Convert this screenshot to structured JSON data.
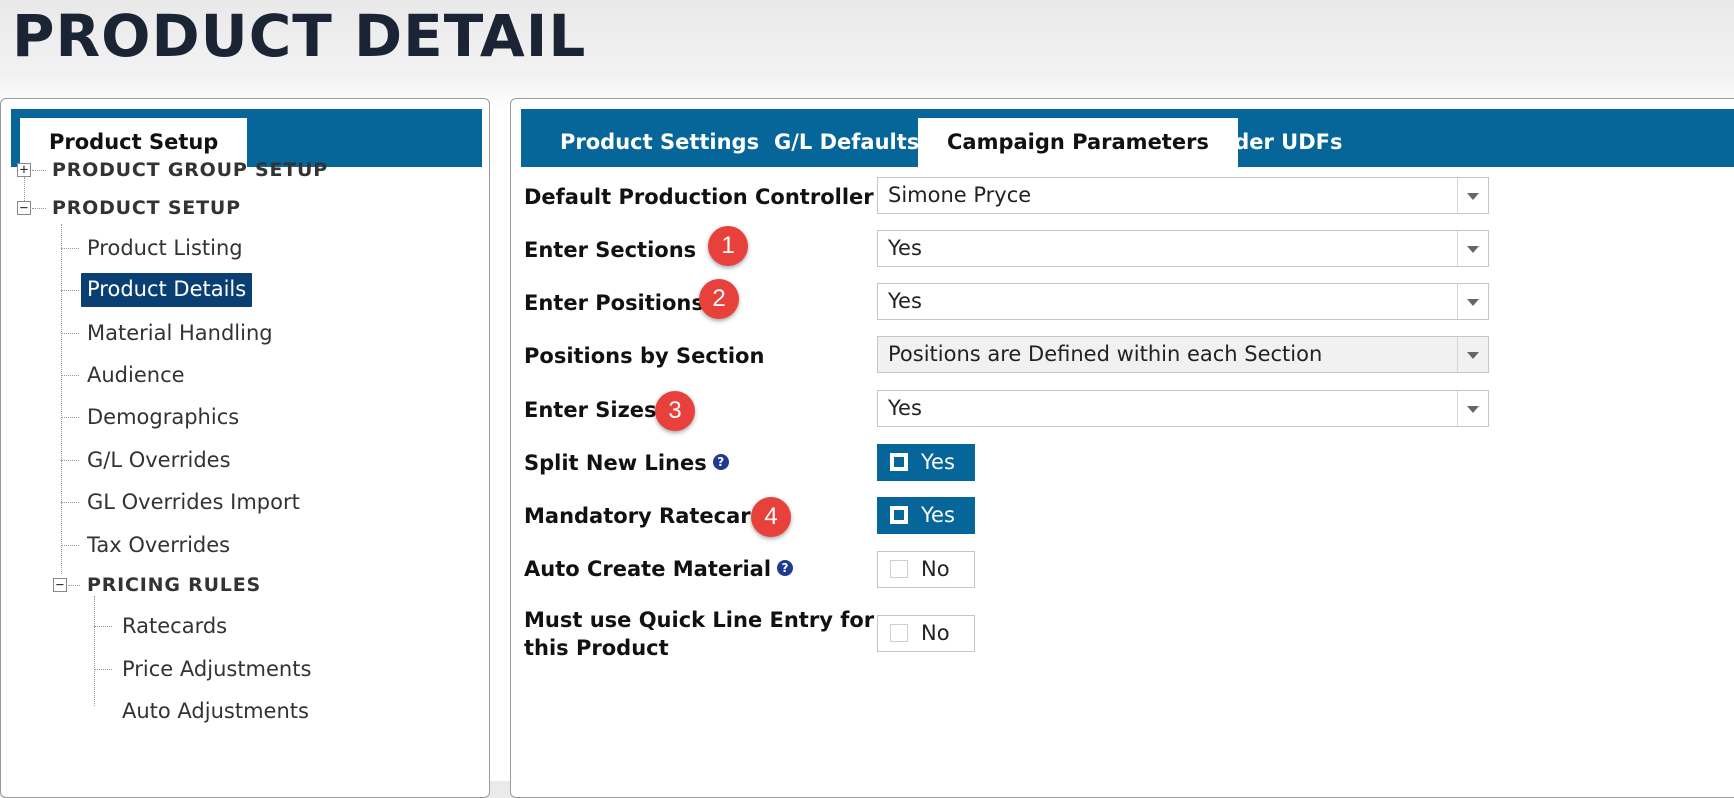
{
  "page": {
    "title": "PRODUCT DETAIL"
  },
  "left_panel": {
    "tabs": [
      {
        "label": "Product Setup",
        "active": true
      }
    ],
    "tree": {
      "group_setup": "PRODUCT GROUP SETUP",
      "product_setup": "PRODUCT SETUP",
      "items": [
        "Product Listing",
        "Product Details",
        "Material Handling",
        "Audience",
        "Demographics",
        "G/L Overrides",
        "GL Overrides Import",
        "Tax Overrides"
      ],
      "selected": "Product Details",
      "pricing_rules": "PRICING RULES",
      "pricing_items": [
        "Ratecards",
        "Price Adjustments"
      ],
      "partial_item": "Auto Adjustments"
    }
  },
  "right_panel": {
    "tabs": [
      {
        "label": "Product Settings"
      },
      {
        "label": "G/L Defaults"
      },
      {
        "label": "Campaign Parameters",
        "active": true
      },
      {
        "label": "Order UDFs"
      }
    ],
    "fields": {
      "default_production_controller": {
        "label": "Default Production Controller",
        "value": "Simone Pryce"
      },
      "enter_sections": {
        "label": "Enter Sections",
        "value": "Yes",
        "badge": "1"
      },
      "enter_positions": {
        "label": "Enter Positions",
        "value": "Yes",
        "badge": "2"
      },
      "positions_by_section": {
        "label": "Positions by Section",
        "value": "Positions are Defined within each Section"
      },
      "enter_sizes": {
        "label": "Enter Sizes",
        "value": "Yes",
        "badge": "3"
      },
      "split_new_lines": {
        "label": "Split New Lines",
        "value": "Yes",
        "checked": true
      },
      "mandatory_ratecard": {
        "label": "Mandatory Ratecard",
        "value": "Yes",
        "checked": true,
        "badge": "4"
      },
      "auto_create_material": {
        "label": "Auto Create Material",
        "value": "No",
        "checked": false
      },
      "quick_line_entry": {
        "label_line1": "Must use Quick Line Entry for",
        "label_line2": "this Product",
        "value": "No",
        "checked": false
      }
    },
    "help_icon": "?"
  },
  "colors": {
    "accent": "#066599",
    "selected": "#0a3f74",
    "badge": "#e8403a",
    "title": "#1a2434"
  }
}
